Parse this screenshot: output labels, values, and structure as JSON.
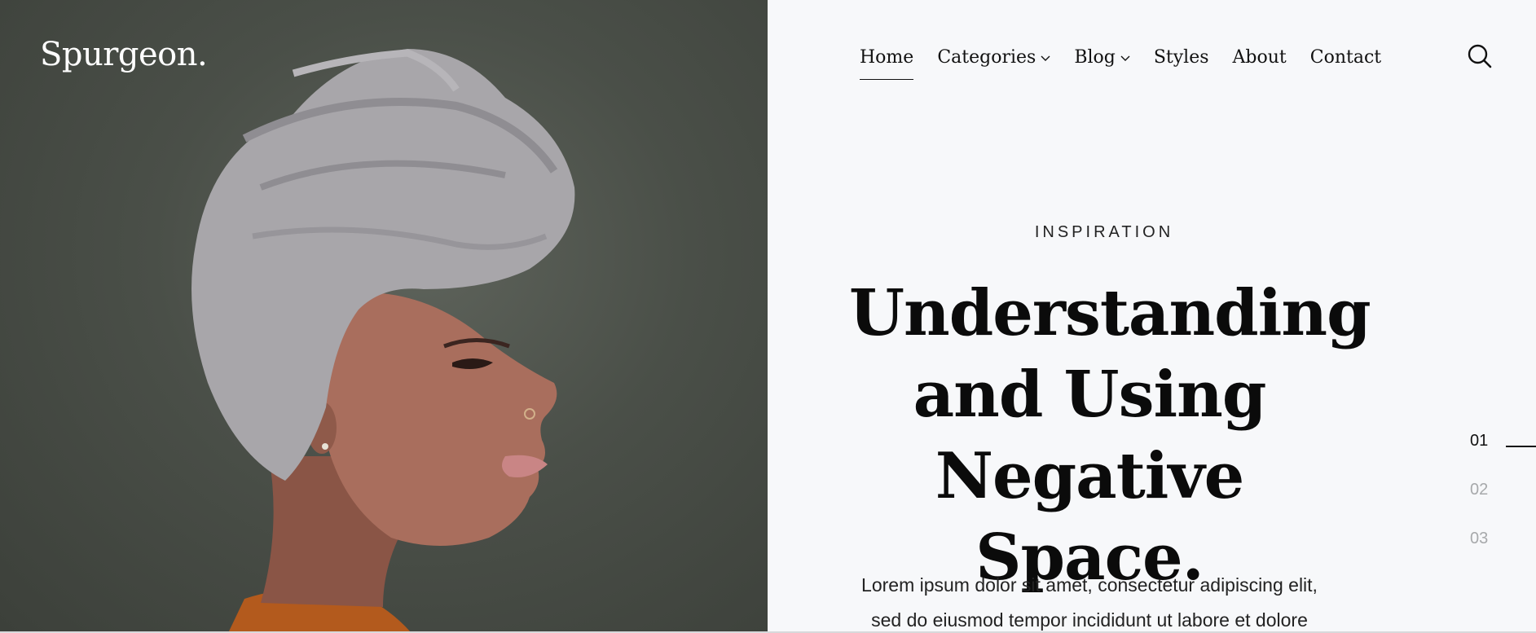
{
  "brand": {
    "logo": "Spurgeon."
  },
  "nav": {
    "items": [
      {
        "label": "Home",
        "active": true,
        "has_dropdown": false
      },
      {
        "label": "Categories",
        "active": false,
        "has_dropdown": true
      },
      {
        "label": "Blog",
        "active": false,
        "has_dropdown": true
      },
      {
        "label": "Styles",
        "active": false,
        "has_dropdown": false
      },
      {
        "label": "About",
        "active": false,
        "has_dropdown": false
      },
      {
        "label": "Contact",
        "active": false,
        "has_dropdown": false
      }
    ],
    "search_icon": "search-icon"
  },
  "hero": {
    "category": "INSPIRATION",
    "title_lines": [
      "Understanding",
      "and Using",
      "Negative Space."
    ],
    "excerpt_lines": [
      "Lorem ipsum dolor sit amet, consectetur adipiscing elit,",
      "sed do eiusmod tempor incididunt ut labore et dolore"
    ]
  },
  "slider": {
    "items": [
      "01",
      "02",
      "03"
    ],
    "active_index": 0
  },
  "colors": {
    "page_bg": "#f7f8fa",
    "text": "#111111",
    "muted": "#a7a9ab",
    "image_bg": "#4a4f48"
  }
}
